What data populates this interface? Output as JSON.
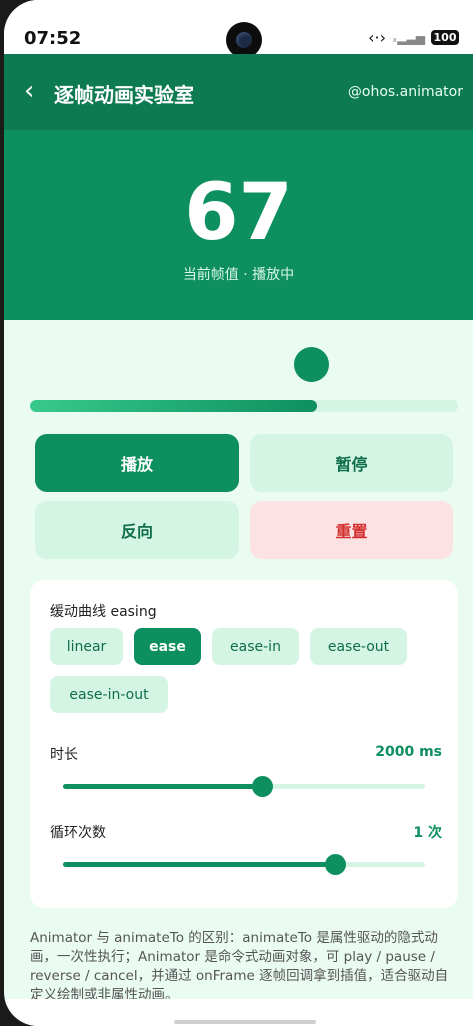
{
  "status_bar": {
    "time": "07:52",
    "battery": "100",
    "signal_icon": "signal-icon",
    "link_icon": "code-icon"
  },
  "app_bar": {
    "back_icon": "chevron-left-icon",
    "title": "逐帧动画实验室",
    "subtitle": "@ohos.animator"
  },
  "hero": {
    "frame_value": "67",
    "caption": "当前帧值 · 播放中"
  },
  "progress": {
    "value_percent": 67
  },
  "controls": {
    "play": "播放",
    "pause": "暂停",
    "reverse": "反向",
    "reset": "重置"
  },
  "settings": {
    "easing_label": "缓动曲线 easing",
    "easing_options": [
      "linear",
      "ease",
      "ease-in",
      "ease-out",
      "ease-in-out"
    ],
    "easing_selected": "ease",
    "duration_label": "时长",
    "duration_value": "2000 ms",
    "duration_fraction": 0.55,
    "loop_label": "循环次数",
    "loop_value": "1 次",
    "loop_fraction": 0.75
  },
  "description": "Animator 与 animateTo 的区别：animateTo 是属性驱动的隐式动画，一次性执行；Animator 是命令式动画对象，可 play / pause / reverse / cancel，并通过 onFrame 逐帧回调拿到插值，适合驱动自定义绘制或非属性动画。",
  "colors": {
    "primary": "#0e8f5f",
    "appbar": "#0e7a52",
    "light": "#d4f4e4",
    "danger": "#d32f2f",
    "danger_bg": "#fde2e3",
    "background": "#eafbf2"
  }
}
